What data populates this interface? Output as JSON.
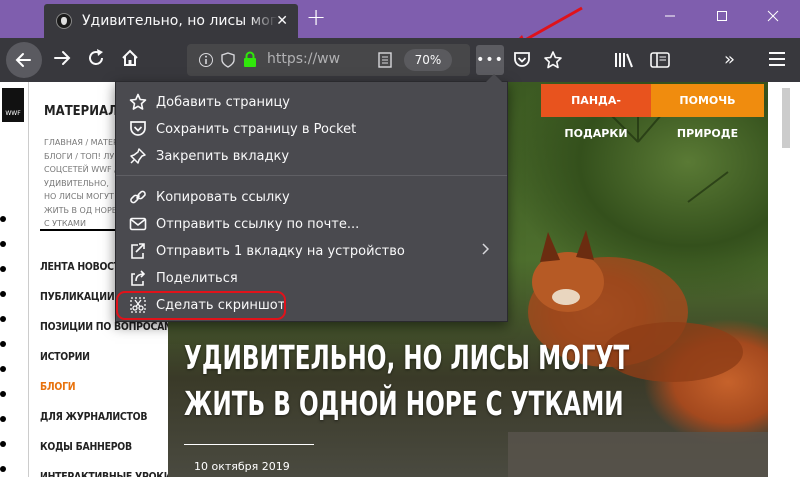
{
  "browser": {
    "tab_title": "Удивительно, но лисы могут",
    "new_tab": "+",
    "url": "https://ww",
    "zoom": "70%"
  },
  "popup": {
    "items": [
      {
        "label": "Добавить страницу",
        "icon": "star-outline-icon"
      },
      {
        "label": "Сохранить страницу в Pocket",
        "icon": "pocket-icon"
      },
      {
        "label": "Закрепить вкладку",
        "icon": "pin-icon"
      },
      {
        "label": "Копировать ссылку",
        "icon": "link-icon"
      },
      {
        "label": "Отправить ссылку по почте...",
        "icon": "mail-icon"
      },
      {
        "label": "Отправить 1 вкладку на устройство",
        "icon": "send-tab-icon"
      },
      {
        "label": "Поделиться",
        "icon": "share-icon"
      },
      {
        "label": "Сделать скриншот",
        "icon": "screenshot-icon"
      }
    ]
  },
  "page": {
    "wwf_logo": "WWF",
    "section_title": "МАТЕРИАЛ",
    "breadcrumb": "ГЛАВНАЯ / МАТЕР БЛОГИ / ТОП! ЛУ СОЦСЕТЕЙ WWF / УДИВИТЕЛЬНО, НО ЛИСЫ МОГУТ ЖИТЬ В ОД НОРЕ С УТКАМИ",
    "menu": [
      {
        "label": "ЛЕНТА НОВОСТЕЙ",
        "active": false
      },
      {
        "label": "ПУБЛИКАЦИИ",
        "active": false
      },
      {
        "label": "ПОЗИЦИИ ПО ВОПРОСАМ",
        "active": false
      },
      {
        "label": "ИСТОРИИ",
        "active": false
      },
      {
        "label": "БЛОГИ",
        "active": true
      },
      {
        "label": "ДЛЯ ЖУРНАЛИСТОВ",
        "active": false
      },
      {
        "label": "КОДЫ БАННЕРОВ",
        "active": false
      },
      {
        "label": "ИНТЕРАКТИВНЫЕ УРОКИ",
        "active": false
      }
    ],
    "btn_gifts": "ПАНДА-ПОДАРКИ",
    "btn_help": "ПОМОЧЬ ПРИРОДЕ",
    "hero_title": "Удивительно, но лисы могут жить в одной норе с утками",
    "date": "10 октября 2019"
  },
  "colors": {
    "titlebar": "#7f5eae",
    "toolbar": "#38383d",
    "gifts": "#e8531e",
    "help": "#f08c0e",
    "highlight": "#e0121a",
    "active_menu": "#e8730e"
  }
}
